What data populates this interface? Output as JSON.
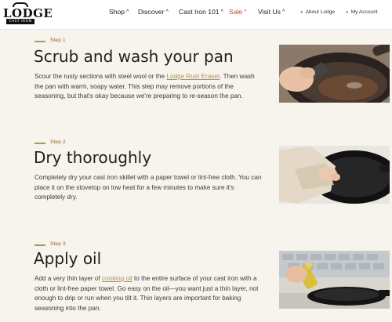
{
  "header": {
    "logo_word": "LODGE",
    "logo_sub": "CAST IRON",
    "nav": [
      {
        "label": "Shop"
      },
      {
        "label": "Discover"
      },
      {
        "label": "Cast Iron 101"
      },
      {
        "label": "Sale"
      },
      {
        "label": "Visit Us"
      }
    ],
    "nav_caret": "^",
    "utility": [
      {
        "label": "About Lodge",
        "icon": "location-pin-icon"
      },
      {
        "label": "My Account",
        "icon": "user-icon"
      }
    ]
  },
  "steps": [
    {
      "label": "Step 1",
      "title": "Scrub and wash your pan",
      "body_before": "Scour the rusty sections with steel wool or the ",
      "body_link": "Lodge Rust Eraser",
      "body_after": ". Then wash the pan with warm, soapy water. This step may remove portions of the seasoning, but that's okay because we're preparing to re-season the pan.",
      "image_alt": "hand-scrubbing-skillet-photo"
    },
    {
      "label": "Step 2",
      "title": "Dry thoroughly",
      "body_before": "Completely dry your cast iron skillet with a paper towel or lint-free cloth. You can place it on the stovetop on low heat for a few minutes to make sure it's completely dry.",
      "body_link": "",
      "body_after": "",
      "image_alt": "hand-drying-skillet-photo"
    },
    {
      "label": "Step 3",
      "title": "Apply oil",
      "body_before": "Add a very thin layer of ",
      "body_link": "cooking oil",
      "body_after": " to the entire surface of your cast iron with a cloth or lint-free paper towel. Go easy on the oil—you want just a thin layer, not enough to drip or run when you tilt it. Thin layers are important for baking seasoning into the pan.",
      "image_alt": "spraying-oil-skillet-photo"
    }
  ],
  "colors": {
    "accent": "#b5934a",
    "sale": "#d4451b",
    "background": "#f7f4ee"
  }
}
